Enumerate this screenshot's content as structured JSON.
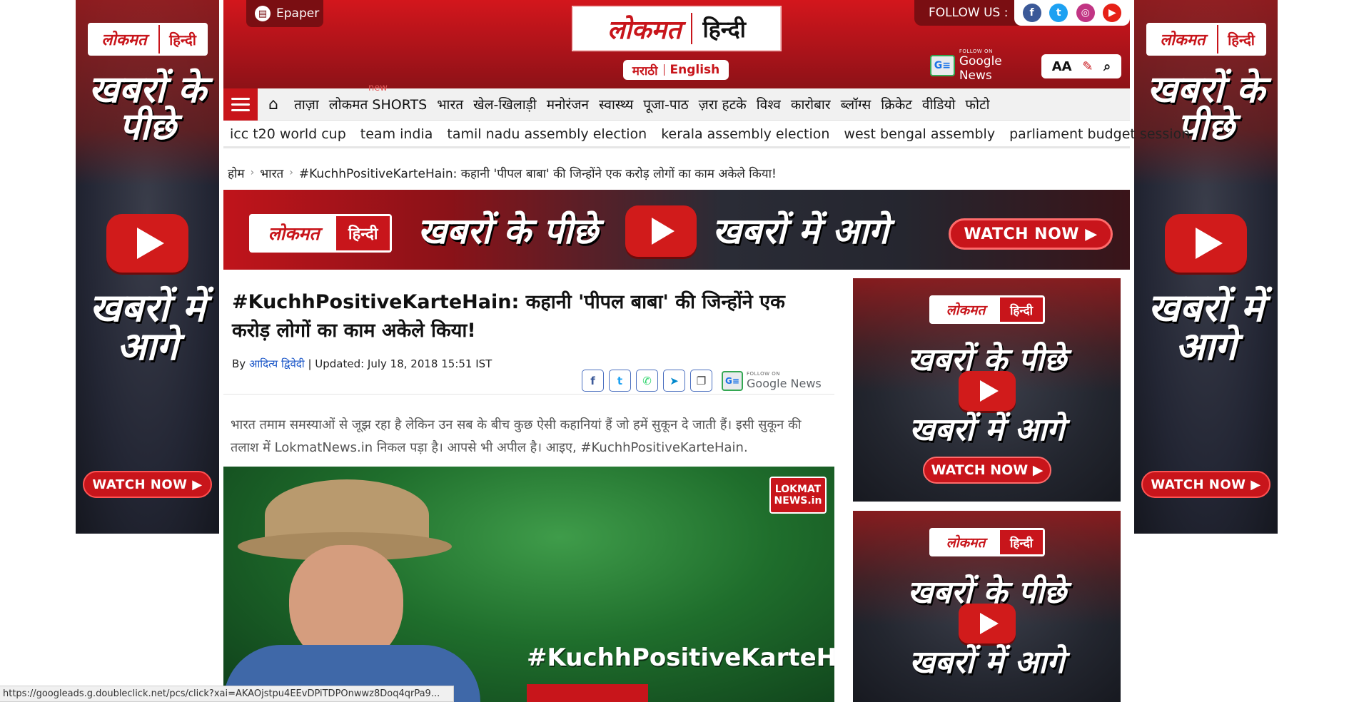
{
  "side_ad": {
    "logo_main": "लोकमत",
    "logo_hindi": "हिन्दी",
    "line1": "खबरों के पीछे",
    "line2": "खबरों में आगे",
    "watch": "WATCH NOW ▶"
  },
  "header": {
    "epaper": "Epaper",
    "brand_main": "लोकमत",
    "brand_hindi": "हिन्दी",
    "lang_marathi": "मराठी",
    "lang_english": "English",
    "follow_label": "FOLLOW US :",
    "gnews_small": "FOLLOW ON",
    "gnews_label": "Google News",
    "font_tool": "AA"
  },
  "nav": {
    "items": [
      "ताज़ा",
      "लोकमत SHORTS",
      "भारत",
      "खेल-खिलाड़ी",
      "मनोरंजन",
      "स्वास्थ्य",
      "पूजा-पाठ",
      "ज़रा हटके",
      "विश्व",
      "कारोबार",
      "ब्लॉग्स",
      "क्रिकेट",
      "वीडियो",
      "फोटो"
    ],
    "new_badge": "new"
  },
  "tags": [
    "icc t20 world cup",
    "team india",
    "tamil nadu assembly election",
    "kerala assembly election",
    "west bengal assembly",
    "parliament budget session"
  ],
  "breadcrumb": {
    "home": "होम",
    "section": "भारत",
    "current": "#KuchhPositiveKarteHain: कहानी 'पीपल बाबा' की जिन्होंने एक करोड़ लोगों का काम अकेले किया!"
  },
  "banner": {
    "logo_main": "लोकमत",
    "logo_hindi": "हिन्दी",
    "text_a": "खबरों के पीछे",
    "text_b": "खबरों में आगे",
    "watch": "WATCH NOW ▶"
  },
  "article": {
    "title": "#KuchhPositiveKarteHain: कहानी 'पीपल बाबा' की जिन्होंने एक करोड़ लोगों का काम अकेले किया!",
    "by": "By",
    "author": "आदित्य द्विवेदी",
    "updated": "| Updated: July 18, 2018 15:51 IST",
    "summary": "भारत तमाम समस्याओं से जूझ रहा है लेकिन उन सब के बीच कुछ ऐसी कहानियां हैं जो हमें सुकून दे जाती हैं। इसी सुकून की तलाश में LokmatNews.in निकल पड़ा है। आपसे भी अपील है। आइए, #KuchhPositiveKarteHain."
  },
  "hero": {
    "hashtag": "#KuchhPositiveKarteHain",
    "badge_line1": "LOKMAT",
    "badge_line2": "NEWS.in"
  },
  "right_ad": {
    "logo_main": "लोकमत",
    "logo_hindi": "हिन्दी",
    "text_a": "खबरों के पीछे",
    "text_b": "खबरों में आगे",
    "watch": "WATCH NOW ▶"
  },
  "status_url": "https://googleads.g.doubleclick.net/pcs/click?xai=AKAOjstpu4EEvDPiTDPOnwwz8Doq4qrPa9..."
}
